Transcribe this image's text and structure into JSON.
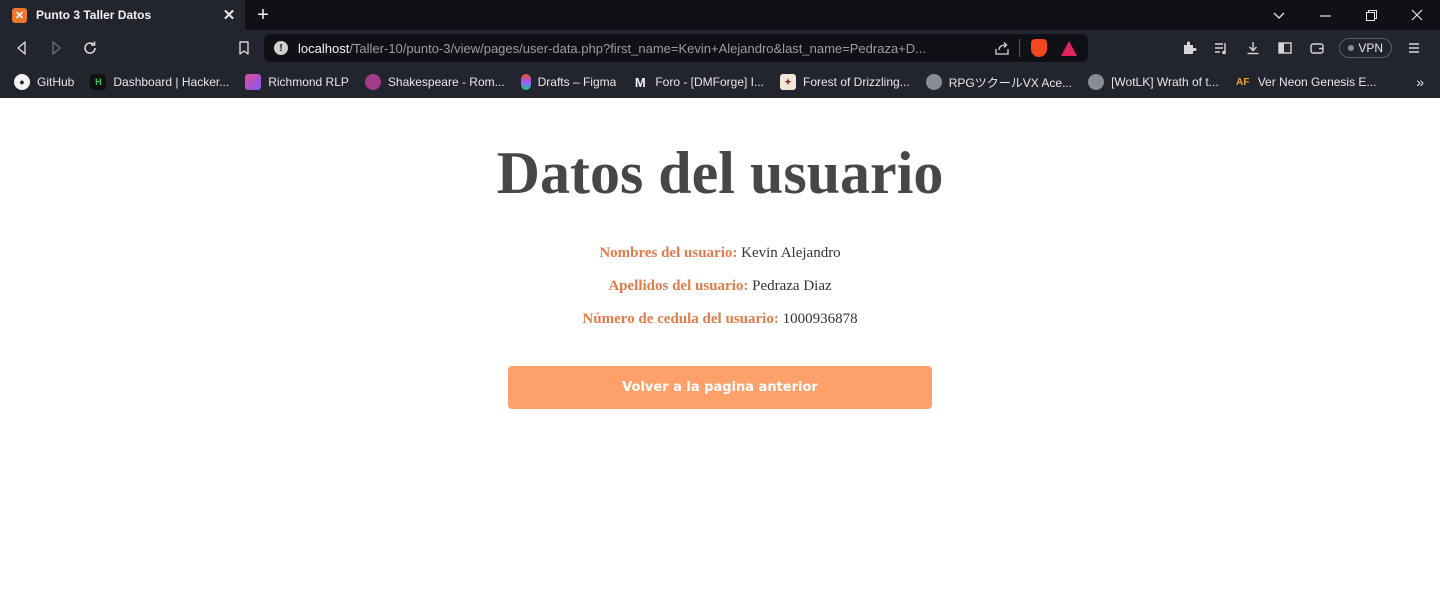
{
  "browser": {
    "tab_title": "Punto 3 Taller Datos",
    "tab_favicon": "xampp-icon",
    "url_host": "localhost",
    "url_path": "/Taller-10/punto-3/view/pages/user-data.php?first_name=Kevin+Alejandro&last_name=Pedraza+D...",
    "vpn_label": "VPN"
  },
  "bookmarks": [
    {
      "label": "GitHub",
      "icon": "github-icon"
    },
    {
      "label": "Dashboard | Hacker...",
      "icon": "hackerrank-icon"
    },
    {
      "label": "Richmond RLP",
      "icon": "richmond-icon"
    },
    {
      "label": "Shakespeare - Rom...",
      "icon": "shakespeare-icon"
    },
    {
      "label": "Drafts – Figma",
      "icon": "figma-icon"
    },
    {
      "label": "Foro - [DMForge] I...",
      "icon": "dmforge-icon"
    },
    {
      "label": "Forest of Drizzling...",
      "icon": "forest-icon"
    },
    {
      "label": "RPGツクールVX Ace...",
      "icon": "globe-icon"
    },
    {
      "label": "[WotLK] Wrath of t...",
      "icon": "globe-icon"
    },
    {
      "label": "Ver Neon Genesis E...",
      "icon": "animeflv-icon"
    }
  ],
  "page": {
    "heading": "Datos del usuario",
    "fields": [
      {
        "label": "Nombres del usuario:",
        "value": "Kevin Alejandro"
      },
      {
        "label": "Apellidos del usuario:",
        "value": "Pedraza Diaz"
      },
      {
        "label": "Número de cedula del usuario:",
        "value": "1000936878"
      }
    ],
    "back_button": "Volver a la pagina anterior"
  },
  "colors": {
    "label_accent": "#e07b4a",
    "button_bg": "#fea06a",
    "heading": "#474747"
  }
}
